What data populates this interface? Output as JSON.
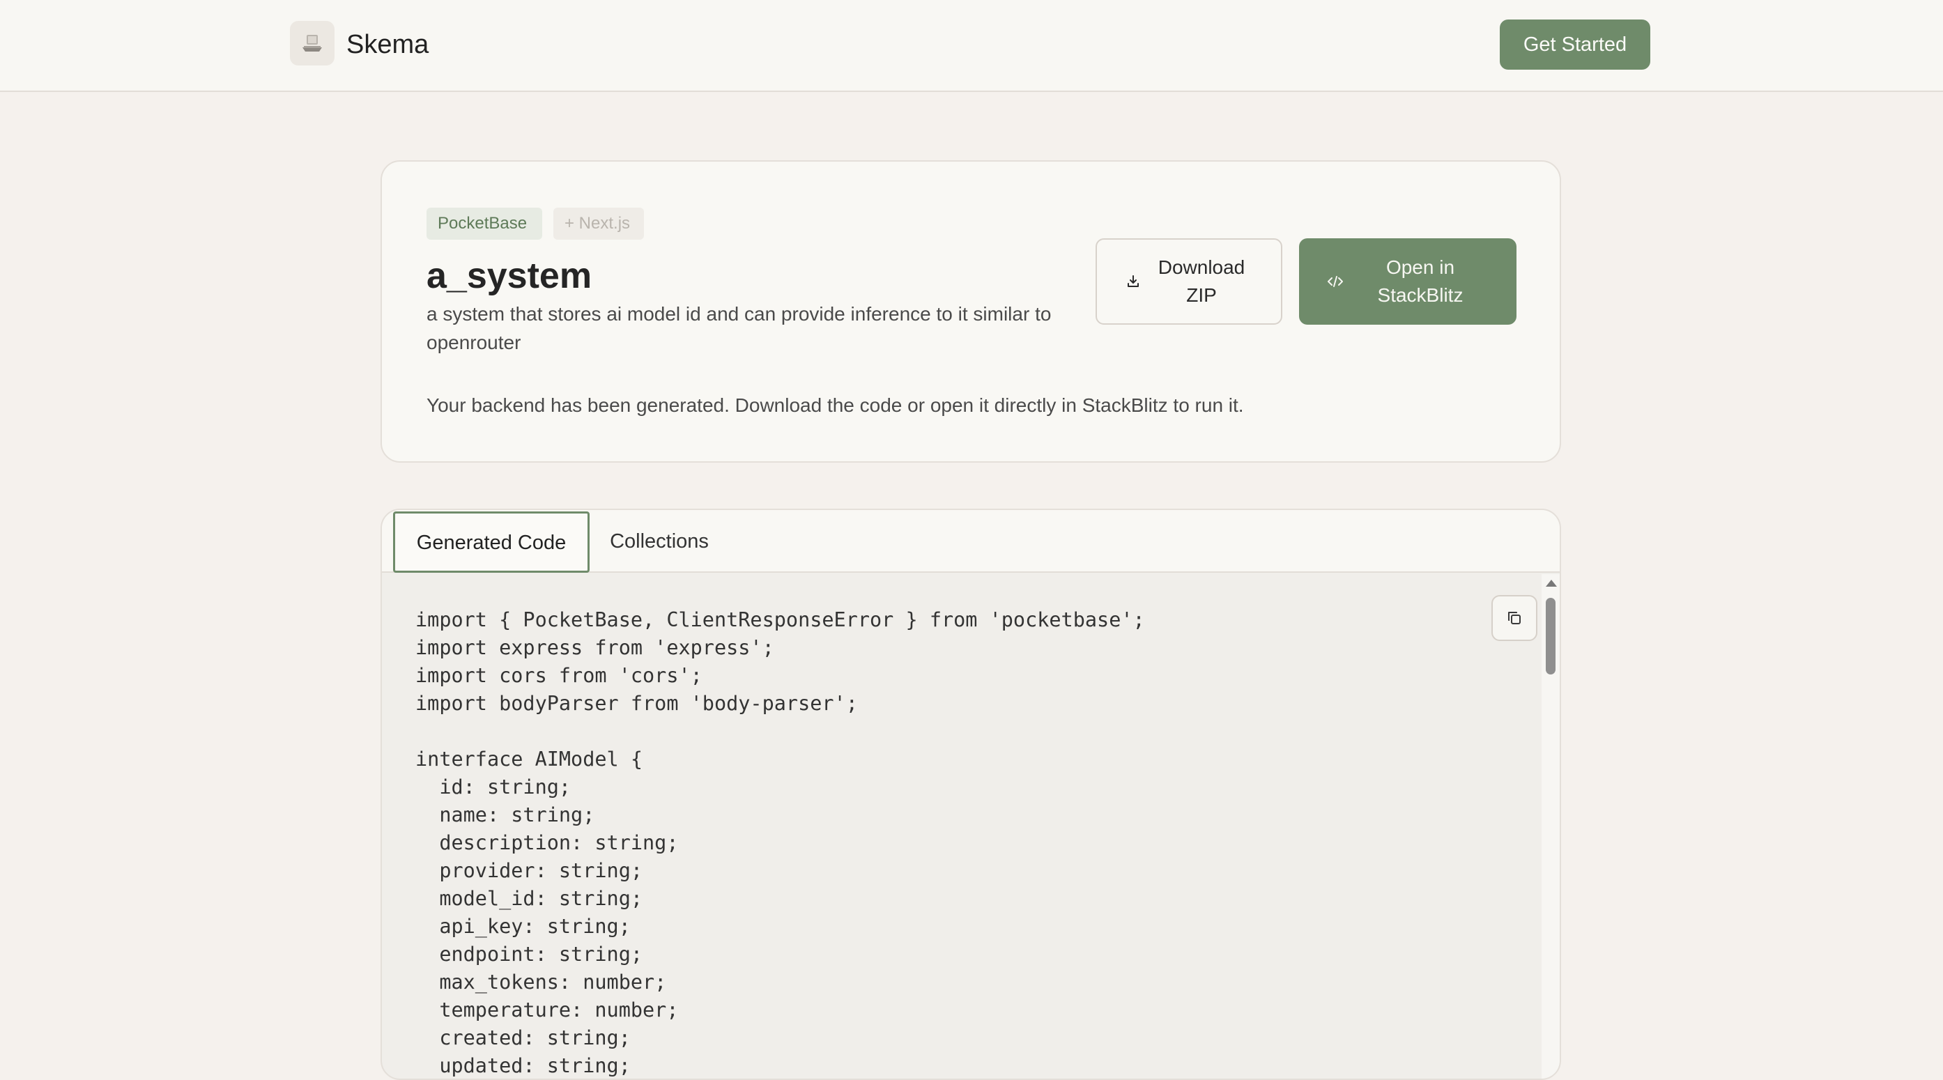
{
  "header": {
    "brand": "Skema",
    "logo_icon": "laptop-icon",
    "cta_label": "Get Started"
  },
  "project": {
    "tags": [
      "PocketBase",
      "+ Next.js"
    ],
    "title": "a_system",
    "description": "a system that stores ai model id and can provide inference to it similar to openrouter",
    "note": "Your backend has been generated. Download the code or open it directly in StackBlitz to run it.",
    "download_label": "Download\nZIP",
    "stackblitz_label": "Open in\nStackBlitz"
  },
  "tabs": {
    "generated_code": "Generated Code",
    "collections": "Collections",
    "active": "Generated Code"
  },
  "code": {
    "text": "import { PocketBase, ClientResponseError } from 'pocketbase';\nimport express from 'express';\nimport cors from 'cors';\nimport bodyParser from 'body-parser';\n\ninterface AIModel {\n  id: string;\n  name: string;\n  description: string;\n  provider: string;\n  model_id: string;\n  api_key: string;\n  endpoint: string;\n  max_tokens: number;\n  temperature: number;\n  created: string;\n  updated: string;"
  },
  "colors": {
    "accent": "#6f8b6a",
    "page_bg": "#f5f1ed",
    "card_bg": "#f9f8f4",
    "code_bg": "#f0eeea"
  }
}
